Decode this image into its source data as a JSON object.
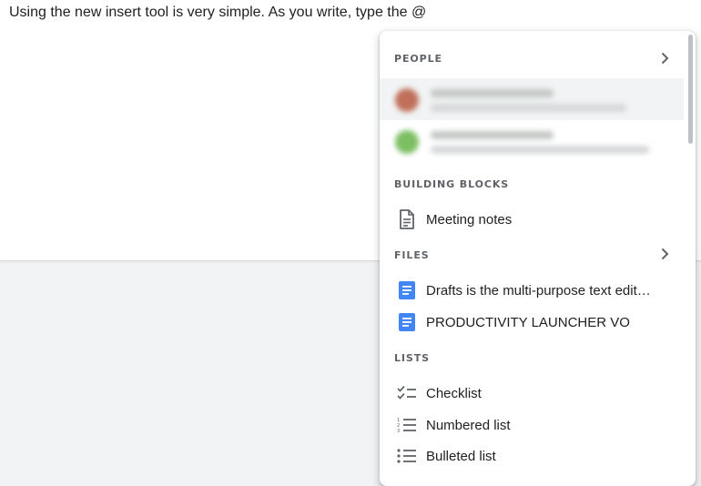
{
  "document": {
    "text": "Using the new insert tool is very simple. As you write, type the @"
  },
  "menu": {
    "people": {
      "header": "PEOPLE",
      "avatar_colors": [
        "#c0705a",
        "#7cbf62"
      ]
    },
    "building_blocks": {
      "header": "BUILDING BLOCKS",
      "items": [
        {
          "label": "Meeting notes",
          "icon": "document-icon"
        }
      ]
    },
    "files": {
      "header": "FILES",
      "items": [
        {
          "label": "Drafts is the multi-purpose text editor for iPhone",
          "icon": "google-doc-icon"
        },
        {
          "label": "PRODUCTIVITY LAUNCHER VO",
          "icon": "google-doc-icon"
        }
      ]
    },
    "lists": {
      "header": "LISTS",
      "items": [
        {
          "label": "Checklist",
          "icon": "checklist-icon"
        },
        {
          "label": "Numbered list",
          "icon": "numbered-list-icon"
        },
        {
          "label": "Bulleted list",
          "icon": "bulleted-list-icon"
        }
      ]
    }
  },
  "colors": {
    "doc_blue": "#4285f4",
    "icon_gray": "#5f6368",
    "highlight": "#f1f3f4"
  }
}
